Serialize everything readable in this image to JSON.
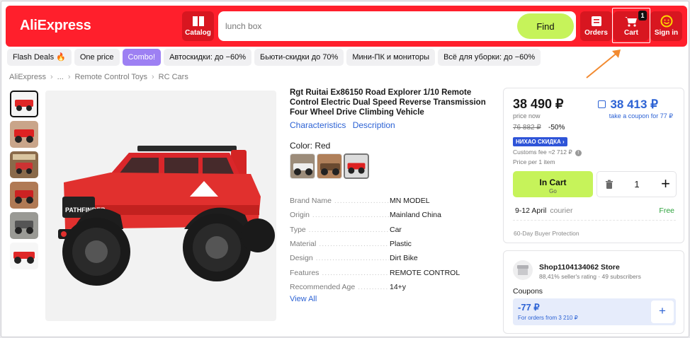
{
  "header": {
    "logo": "AliExpress",
    "catalog_label": "Catalog",
    "search_placeholder": "lunch box",
    "find_label": "Find",
    "orders_label": "Orders",
    "cart_label": "Cart",
    "cart_count": "1",
    "signin_label": "Sign in",
    "brand_color": "#ff1f2c"
  },
  "chips": [
    "Flash Deals",
    "One price",
    "Combo!",
    "Автоскидки: до −60%",
    "Бьюти-скидки до 70%",
    "Мини-ПК и мониторы",
    "Всё для уборки: до −60%"
  ],
  "breadcrumb": [
    "AliExpress",
    "...",
    "Remote Control Toys",
    "RC Cars"
  ],
  "product": {
    "title": "Rgt Ruitai Ex86150 Road Explorer 1/10 Remote Control Electric Dual Speed Reverse Transmission Four Wheel Drive Climbing Vehicle",
    "tab_characteristics": "Characteristics",
    "tab_description": "Description",
    "color_label": "Color: Red",
    "specs": [
      {
        "k": "Brand Name",
        "v": "MN MODEL"
      },
      {
        "k": "Origin",
        "v": "Mainland China"
      },
      {
        "k": "Type",
        "v": "Car"
      },
      {
        "k": "Material",
        "v": "Plastic"
      },
      {
        "k": "Design",
        "v": "Dirt Bike"
      },
      {
        "k": "Features",
        "v": "REMOTE CONTROL"
      },
      {
        "k": "Recommended Age",
        "v": "14+y"
      }
    ],
    "view_all": "View All",
    "image_badge": "PATHFINDER"
  },
  "price": {
    "current": "38 490 ₽",
    "now_label": "price now",
    "coupon_price": "38 413 ₽",
    "coupon_note": "take a coupon for 77 ₽",
    "old": "76 882 ₽",
    "discount": "-50%",
    "promo": "НИХАО СКИДКА ›",
    "customs": "Customs fee ≈2 712 ₽",
    "per_item": "Price per 1 item",
    "in_cart": "In Cart",
    "go": "Go",
    "quantity": "1",
    "delivery_dates": "9-12 April",
    "delivery_type": "courier",
    "delivery_cost": "Free",
    "protection": "60-Day Buyer Protection"
  },
  "store": {
    "name": "Shop1104134062 Store",
    "meta": "88,41% seller's rating · 49 subscribers",
    "coupons_label": "Coupons",
    "coupon_amount": "-77 ₽",
    "coupon_condition": "For orders from 3 210 ₽"
  }
}
